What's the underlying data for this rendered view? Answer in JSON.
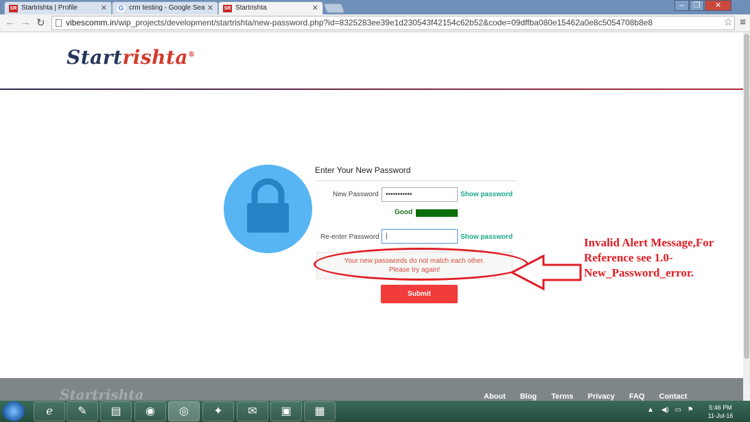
{
  "browser": {
    "tabs": [
      {
        "label": "Startrishta | Profile",
        "favicon": "SR"
      },
      {
        "label": "crm testing - Google Sea",
        "favicon": "G"
      },
      {
        "label": "Startrishta",
        "favicon": "SR"
      }
    ],
    "url_host": "vibescomm.in",
    "url_path": "/wip_projects/development/startrishta/new-password.php?id=8325283ee39e1d230543f42154c62b52&code=09dffba080e15462a0e8c5054708b8e8"
  },
  "logo": {
    "part1": "Start",
    "part2": "rishta",
    "reg": "®"
  },
  "form": {
    "heading": "Enter Your New Password",
    "new_password_label": "New Password",
    "new_password_value": "•••••••••••",
    "show_password": "Show password",
    "strength_label": "Good",
    "reenter_label": "Re-enter Password",
    "reenter_value": "|",
    "alert_line1": "Your new passwords do not match each other.",
    "alert_line2": "Please try again!",
    "submit_label": "Submit"
  },
  "annotation": {
    "text": "Invalid Alert Message,For Reference see 1.0-New_Password_error."
  },
  "footer": {
    "logo": "Startrishta",
    "links": [
      "About",
      "Blog",
      "Terms",
      "Privacy",
      "FAQ",
      "Contact"
    ]
  },
  "taskbar": {
    "time": "5:46 PM",
    "date": "11-Jul-16"
  },
  "colors": {
    "accent_red": "#f23b3b",
    "annotation_red": "#e11c24",
    "lock_blue": "#56b5f2",
    "link_teal": "#1aaa8a"
  }
}
